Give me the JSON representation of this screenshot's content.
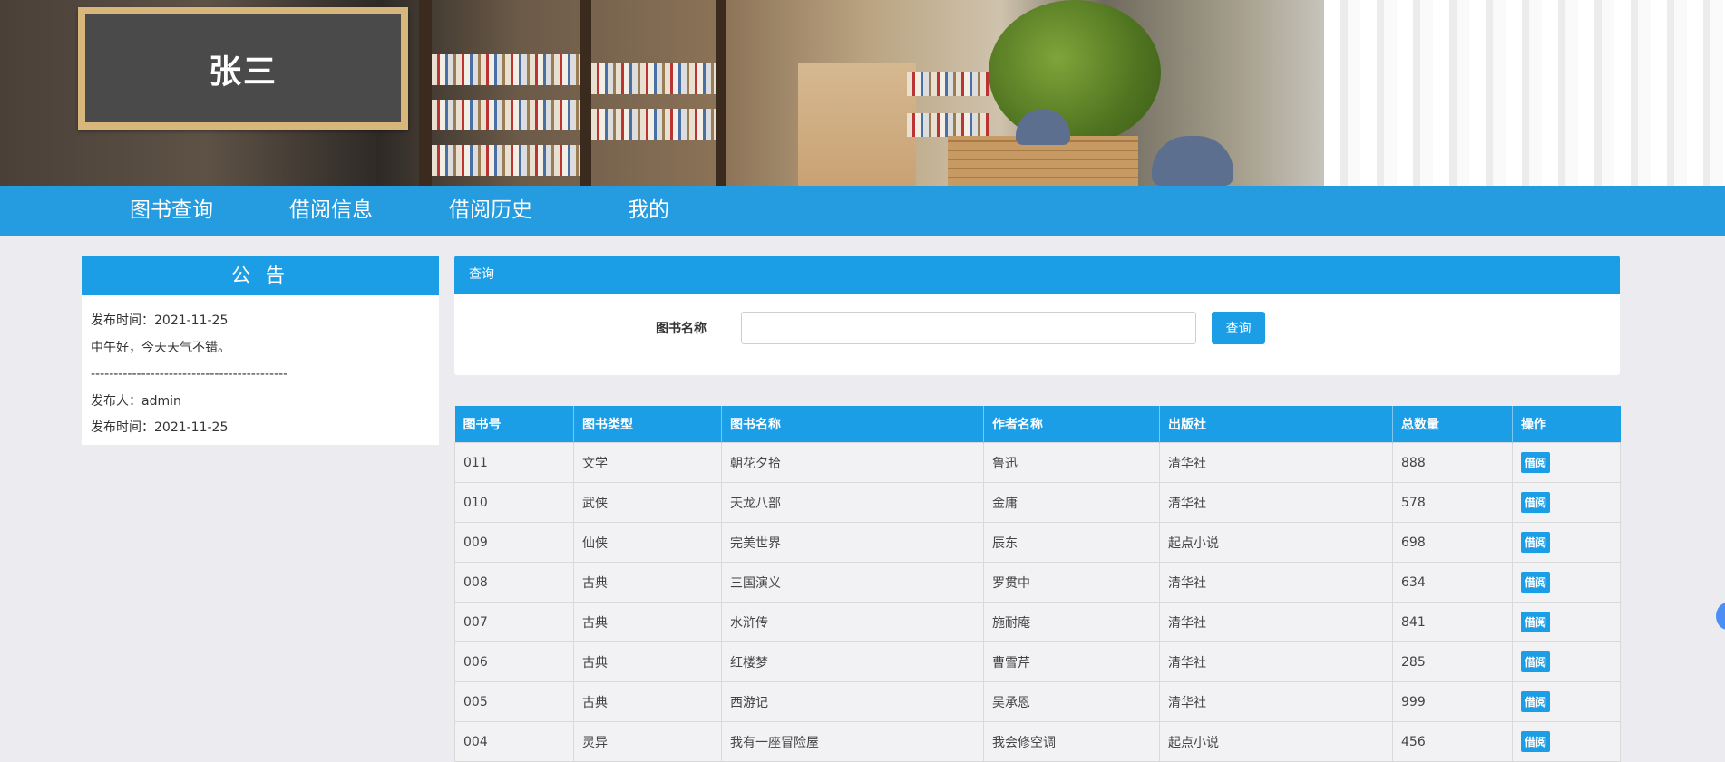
{
  "board": {
    "name": "张三"
  },
  "nav": {
    "items": [
      "图书查询",
      "借阅信息",
      "借阅历史",
      "我的"
    ]
  },
  "notice": {
    "title": "公 告",
    "lines": [
      "发布时间：2021-11-25",
      "中午好，今天天气不错。",
      "-------------------------------------------",
      "发布人：admin",
      "发布时间：2021-11-25"
    ]
  },
  "query": {
    "title": "查询",
    "label": "图书名称",
    "input_value": "",
    "button": "查询"
  },
  "table": {
    "headers": [
      "图书号",
      "图书类型",
      "图书名称",
      "作者名称",
      "出版社",
      "总数量",
      "操作"
    ],
    "action_label": "借阅",
    "rows": [
      [
        "011",
        "文学",
        "朝花夕拾",
        "鲁迅",
        "清华社",
        "888"
      ],
      [
        "010",
        "武侠",
        "天龙八部",
        "金庸",
        "清华社",
        "578"
      ],
      [
        "009",
        "仙侠",
        "完美世界",
        "辰东",
        "起点小说",
        "698"
      ],
      [
        "008",
        "古典",
        "三国演义",
        "罗贯中",
        "清华社",
        "634"
      ],
      [
        "007",
        "古典",
        "水浒传",
        "施耐庵",
        "清华社",
        "841"
      ],
      [
        "006",
        "古典",
        "红楼梦",
        "曹雪芹",
        "清华社",
        "285"
      ],
      [
        "005",
        "古典",
        "西游记",
        "吴承恩",
        "清华社",
        "999"
      ],
      [
        "004",
        "灵异",
        "我有一座冒险屋",
        "我会修空调",
        "起点小说",
        "456"
      ]
    ]
  },
  "colors": {
    "primary": "#1b9ee6",
    "nav_bar": "#1696de",
    "background": "#ebebf0"
  }
}
